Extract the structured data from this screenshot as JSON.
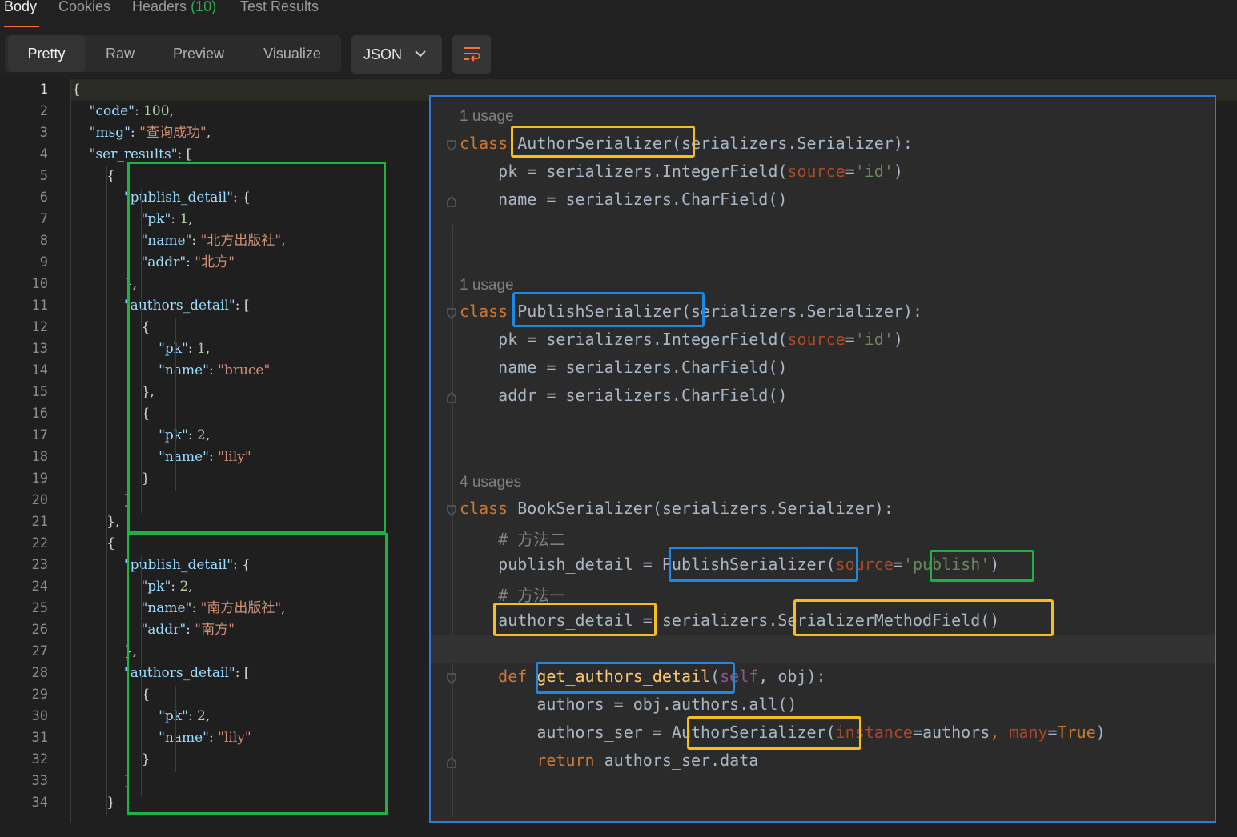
{
  "tabs": {
    "body": "Body",
    "cookies": "Cookies",
    "headers_label": "Headers",
    "headers_count": "(10)",
    "tests": "Test Results"
  },
  "view_modes": [
    "Pretty",
    "Raw",
    "Preview",
    "Visualize"
  ],
  "format_select": "JSON",
  "icons": {
    "dropdown": "chevron-down-icon",
    "wrap": "wrap-lines-icon"
  },
  "colors": {
    "accent": "#ff6c37",
    "green_box": "#1db344",
    "yellow_box": "#f5bd1f",
    "blue_box": "#1e88e5"
  },
  "json_lines": [
    "{",
    "    \"code\": 100,",
    "    \"msg\": \"查询成功\",",
    "    \"ser_results\": [",
    "        {",
    "            \"publish_detail\": {",
    "                \"pk\": 1,",
    "                \"name\": \"北方出版社\",",
    "                \"addr\": \"北方\"",
    "            },",
    "            \"authors_detail\": [",
    "                {",
    "                    \"pk\": 1,",
    "                    \"name\": \"bruce\"",
    "                },",
    "                {",
    "                    \"pk\": 2,",
    "                    \"name\": \"lily\"",
    "                }",
    "            ]",
    "        },",
    "        {",
    "            \"publish_detail\": {",
    "                \"pk\": 2,",
    "                \"name\": \"南方出版社\",",
    "                \"addr\": \"南方\"",
    "            },",
    "            \"authors_detail\": [",
    "                {",
    "                    \"pk\": 2,",
    "                    \"name\": \"lily\"",
    "                }",
    "            ]",
    "        }"
  ],
  "ide": {
    "usage1": "1 usage",
    "usage2": "1 usage",
    "usage3": "4 usages",
    "author_class": {
      "kw": "class",
      "name": "AuthorSerializer",
      "base": "(serializers.Serializer):",
      "line1_a": "    pk = serializers.IntegerField(",
      "line1_p": "source",
      "line1_eq": "=",
      "line1_s": "'id'",
      "line1_c": ")",
      "line2": "    name = serializers.CharField()"
    },
    "publish_class": {
      "kw": "class",
      "name": "PublishSerializer",
      "base": "(serializers.Serializer):",
      "line1_a": "    pk = serializers.IntegerField(",
      "line1_p": "source",
      "line1_eq": "=",
      "line1_s": "'id'",
      "line1_c": ")",
      "line2": "    name = serializers.CharField()",
      "line3": "    addr = serializers.CharField()"
    },
    "book_class": {
      "kw": "class",
      "head": " BookSerializer(serializers.Serializer):",
      "comment1": "    # 方法二",
      "pd_a": "    publish_detail = ",
      "pd_ser": "PublishSerializer",
      "pd_paren": "(",
      "pd_p": "source",
      "pd_eq": "=",
      "pd_s": "'publish'",
      "pd_c": ")",
      "comment2": "    # 方法一",
      "ad_name": "    authors_detail",
      "ad_mid": " = serializers.",
      "ad_field": "SerializerMethodField()",
      "def_kw": "    def ",
      "def_name": "get_authors_detail",
      "def_p": "(",
      "def_self": "self",
      "def_rest": ", obj):",
      "body1": "        authors = obj.authors.all()",
      "body2_a": "        authors_ser = ",
      "body2_cls": "AuthorSerializer",
      "body2_p": "(",
      "body2_inst": "instance",
      "body2_eq": "=authors",
      "body2_comma": ", ",
      "body2_many": "many",
      "body2_eq2": "=",
      "body2_true": "True",
      "body2_c": ")",
      "ret_kw": "        return",
      "ret_rest": " authors_ser.data"
    }
  }
}
